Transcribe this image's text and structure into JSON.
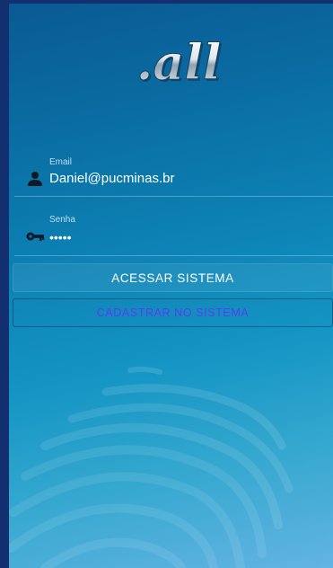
{
  "brand": {
    "logo_text": ".all"
  },
  "form": {
    "email": {
      "label": "Email",
      "value": "Daniel@pucminas.br",
      "icon": "person-icon"
    },
    "password": {
      "label": "Senha",
      "value": "•••••",
      "icon": "key-icon"
    },
    "login_label": "ACESSAR SISTEMA",
    "register_label": "CADASTRAR NO SISTEMA"
  },
  "colors": {
    "frame": "#12306f",
    "gradient_top": "#0a5a93",
    "gradient_bottom": "#63b4e2",
    "register_text": "#5a3cf5",
    "text": "#ffffff"
  }
}
